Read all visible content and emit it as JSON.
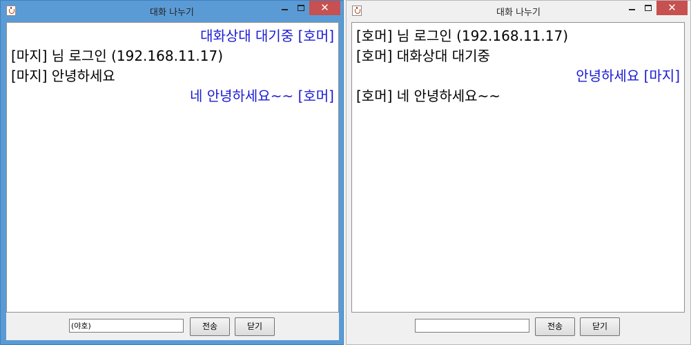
{
  "left_window": {
    "title": "대화 나누기",
    "close_glyph": "✕",
    "messages": [
      {
        "text": "대화상대 대기중 [호머]",
        "mine": true
      },
      {
        "text": "[마지] 님 로그인 (192.168.11.17)",
        "mine": false
      },
      {
        "text": "[마지] 안녕하세요",
        "mine": false
      },
      {
        "text": "네 안녕하세요~~ [호머]",
        "mine": true
      }
    ],
    "input_value": "(야호)",
    "send_label": "전송",
    "close_label": "닫기"
  },
  "right_window": {
    "title": "대화 나누기",
    "close_glyph": "✕",
    "messages": [
      {
        "text": "[호머] 님 로그인 (192.168.11.17)",
        "mine": false
      },
      {
        "text": "[호머] 대화상대 대기중",
        "mine": false
      },
      {
        "text": "안녕하세요 [마지]",
        "mine": true
      },
      {
        "text": "[호머] 네 안녕하세요~~",
        "mine": false
      }
    ],
    "input_value": "",
    "send_label": "전송",
    "close_label": "닫기"
  },
  "colors": {
    "active_frame": "#5b9bd5",
    "inactive_frame": "#f0f0f0",
    "close_button": "#c75050",
    "own_message_text": "#1a1ad4"
  }
}
